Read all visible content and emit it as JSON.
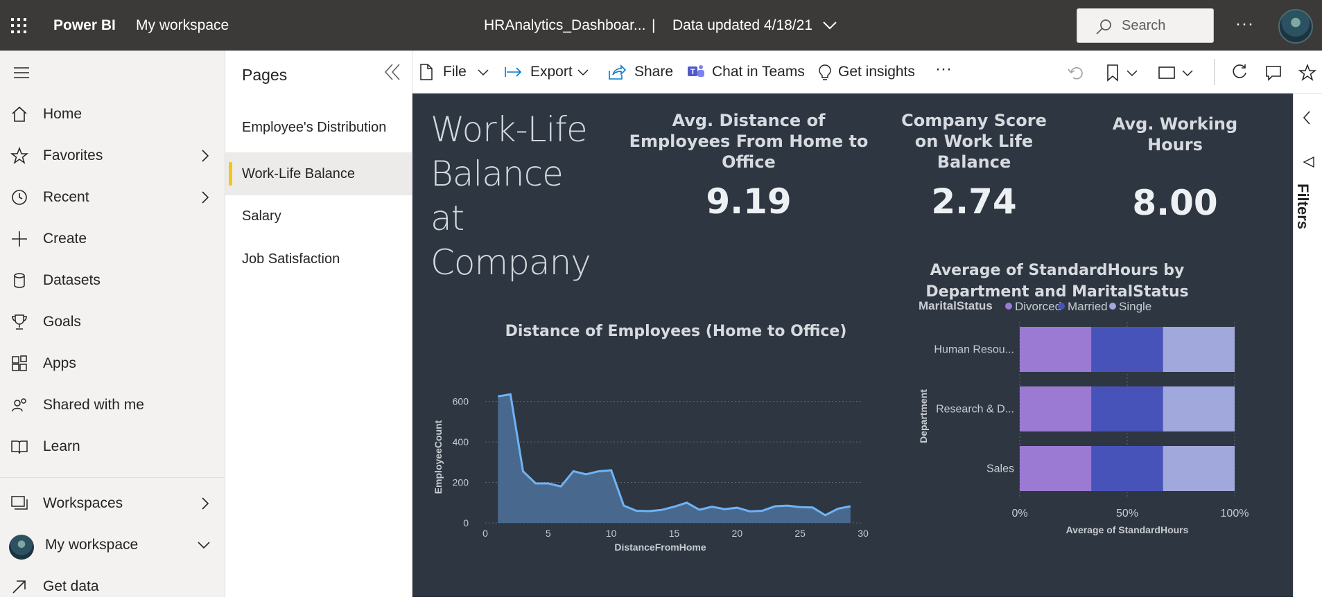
{
  "topbar": {
    "brand": "Power BI",
    "workspace": "My workspace",
    "report_title": "HRAnalytics_Dashboar...",
    "separator": "|",
    "data_updated": "Data updated 4/18/21",
    "search_placeholder": "Search",
    "more": "···"
  },
  "nav": {
    "items": [
      {
        "label": "Home",
        "icon": "home-icon"
      },
      {
        "label": "Favorites",
        "icon": "star-icon"
      },
      {
        "label": "Recent",
        "icon": "clock-icon"
      },
      {
        "label": "Create",
        "icon": "plus-icon"
      },
      {
        "label": "Datasets",
        "icon": "database-icon"
      },
      {
        "label": "Goals",
        "icon": "trophy-icon"
      },
      {
        "label": "Apps",
        "icon": "apps-icon"
      },
      {
        "label": "Shared with me",
        "icon": "shared-icon"
      },
      {
        "label": "Learn",
        "icon": "book-icon"
      },
      {
        "label": "Workspaces",
        "icon": "workspaces-icon"
      },
      {
        "label": "My workspace",
        "icon": "avatar"
      },
      {
        "label": "Get data",
        "icon": "arrow-up-right-icon"
      }
    ]
  },
  "pages_pane": {
    "title": "Pages",
    "pages": [
      "Employee's Distribution",
      "Work-Life Balance",
      "Salary",
      "Job Satisfaction"
    ],
    "active": "Work-Life Balance"
  },
  "actionbar": {
    "file": "File",
    "export": "Export",
    "share": "Share",
    "chat_in_teams": "Chat in Teams",
    "get_insights": "Get insights",
    "more": "···"
  },
  "filters_label": "Filters",
  "report": {
    "title": "Work-Life Balance at Company",
    "kpis": [
      {
        "label": "Avg. Distance of Employees From Home to Office",
        "value": "9.19"
      },
      {
        "label": "Company Score on Work Life Balance",
        "value": "2.74"
      },
      {
        "label": "Avg. Working Hours",
        "value": "8.00"
      }
    ]
  },
  "colors": {
    "canvas_bg": "#2e3641",
    "area_fill": "#4a6d91",
    "line": "#6fb3f5",
    "divorced": "#9b7ad4",
    "married": "#4753b8",
    "single": "#a0a8dc",
    "accent": "#f2c811"
  },
  "chart_data": [
    {
      "type": "area",
      "title": "Distance of Employees (Home to Office)",
      "xlabel": "DistanceFromHome",
      "ylabel": "EmployeeCount",
      "xlim": [
        0,
        30
      ],
      "ylim": [
        0,
        650
      ],
      "xticks": [
        0,
        5,
        10,
        15,
        20,
        25,
        30
      ],
      "yticks": [
        0,
        200,
        400,
        600
      ],
      "grid": true,
      "x": [
        1,
        2,
        3,
        4,
        5,
        6,
        7,
        8,
        9,
        10,
        11,
        12,
        13,
        14,
        15,
        16,
        17,
        18,
        19,
        20,
        21,
        22,
        23,
        24,
        25,
        26,
        27,
        28,
        29
      ],
      "y": [
        625,
        635,
        255,
        195,
        195,
        180,
        255,
        240,
        255,
        260,
        85,
        60,
        58,
        64,
        80,
        100,
        65,
        80,
        68,
        75,
        57,
        60,
        82,
        85,
        78,
        76,
        38,
        70,
        82
      ]
    },
    {
      "type": "bar",
      "orientation": "horizontal",
      "stacked": "100%",
      "title": "Average of StandardHours by Department and MaritalStatus",
      "legend_title": "MaritalStatus",
      "legend_position": "top-left",
      "xlabel": "Average of StandardHours",
      "ylabel": "Department",
      "categories": [
        "Human Resou...",
        "Research & D...",
        "Sales"
      ],
      "xticks": [
        "0%",
        "50%",
        "100%"
      ],
      "series": [
        {
          "name": "Divorced",
          "values": [
            33.33,
            33.33,
            33.33
          ]
        },
        {
          "name": "Married",
          "values": [
            33.33,
            33.33,
            33.33
          ]
        },
        {
          "name": "Single",
          "values": [
            33.34,
            33.34,
            33.34
          ]
        }
      ]
    }
  ]
}
